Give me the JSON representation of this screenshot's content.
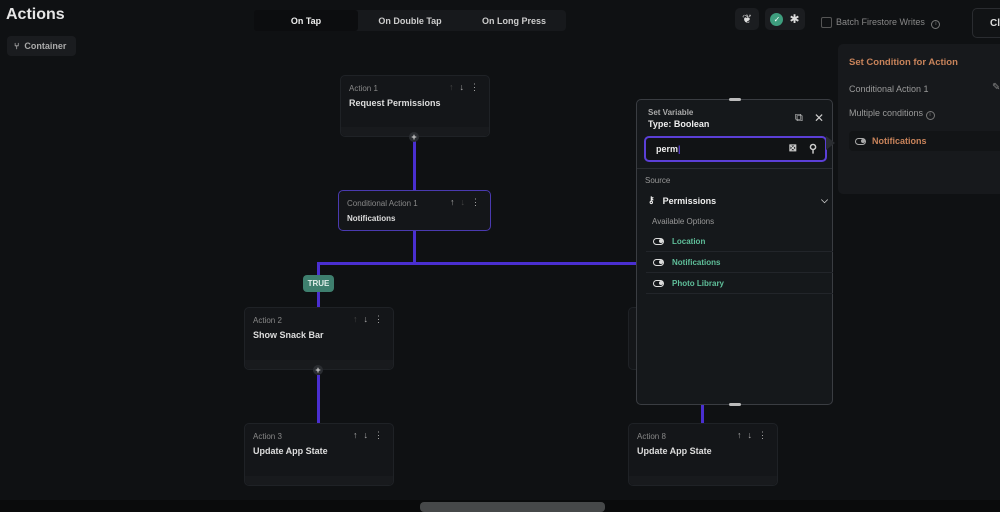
{
  "header": {
    "title": "Actions",
    "container_label": "Container",
    "close_label": "Close"
  },
  "tabs": [
    {
      "label": "On Tap",
      "active": true
    },
    {
      "label": "On Double Tap",
      "active": false
    },
    {
      "label": "On Long Press",
      "active": false
    }
  ],
  "toolbar": {
    "batch_label": "Batch Firestore Writes",
    "batch_checked": false
  },
  "condition_panel": {
    "title": "Set Condition for Action",
    "name": "Conditional Action 1",
    "multiple_label": "Multiple conditions",
    "condition_value": "Notifications"
  },
  "nodes": {
    "a1": {
      "label": "Action 1",
      "name": "Request Permissions"
    },
    "c1": {
      "label": "Conditional Action 1",
      "name": "Notifications"
    },
    "true_badge": "TRUE",
    "a2": {
      "label": "Action 2",
      "name": "Show Snack Bar"
    },
    "a3": {
      "label": "Action 3",
      "name": "Update App State"
    },
    "a8": {
      "label": "Action 8",
      "name": "Update App State"
    }
  },
  "popup": {
    "subtitle": "Set Variable",
    "type": "Type: Boolean",
    "search_value": "perm",
    "source_label": "Source",
    "source_name": "Permissions",
    "available_label": "Available Options",
    "options": [
      "Location",
      "Notifications",
      "Photo Library"
    ]
  },
  "colors": {
    "accent": "#4a2fd0",
    "true": "#3e7f6e",
    "condition": "#c8835a",
    "option": "#5fbf9a"
  }
}
